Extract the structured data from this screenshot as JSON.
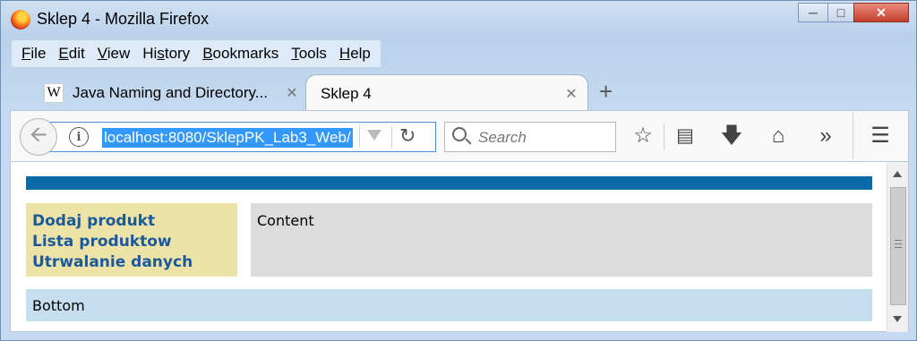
{
  "window": {
    "title": "Sklep 4 - Mozilla Firefox"
  },
  "menu": [
    {
      "pre": "",
      "u": "F",
      "post": "ile"
    },
    {
      "pre": "",
      "u": "E",
      "post": "dit"
    },
    {
      "pre": "",
      "u": "V",
      "post": "iew"
    },
    {
      "pre": "Hi",
      "u": "s",
      "post": "tory"
    },
    {
      "pre": "",
      "u": "B",
      "post": "ookmarks"
    },
    {
      "pre": "",
      "u": "T",
      "post": "ools"
    },
    {
      "pre": "",
      "u": "H",
      "post": "elp"
    }
  ],
  "tabs": [
    {
      "label": "Java Naming and Directory...",
      "favicon": "W"
    },
    {
      "label": "Sklep 4"
    }
  ],
  "urlbar": {
    "url": "localhost:8080/SklepPK_Lab3_Web/"
  },
  "search": {
    "placeholder": "Search"
  },
  "page": {
    "menu_links": [
      "Dodaj produkt",
      "Lista produktow",
      "Utrwalanie danych"
    ],
    "content": "Content",
    "bottom": "Bottom"
  },
  "colors": {
    "header_bar": "#0b6aa8",
    "menu_bg": "#eee3a6",
    "content_bg": "#dcdcdc",
    "bottom_bg": "#c5dff0",
    "link": "#1a5a9c"
  }
}
